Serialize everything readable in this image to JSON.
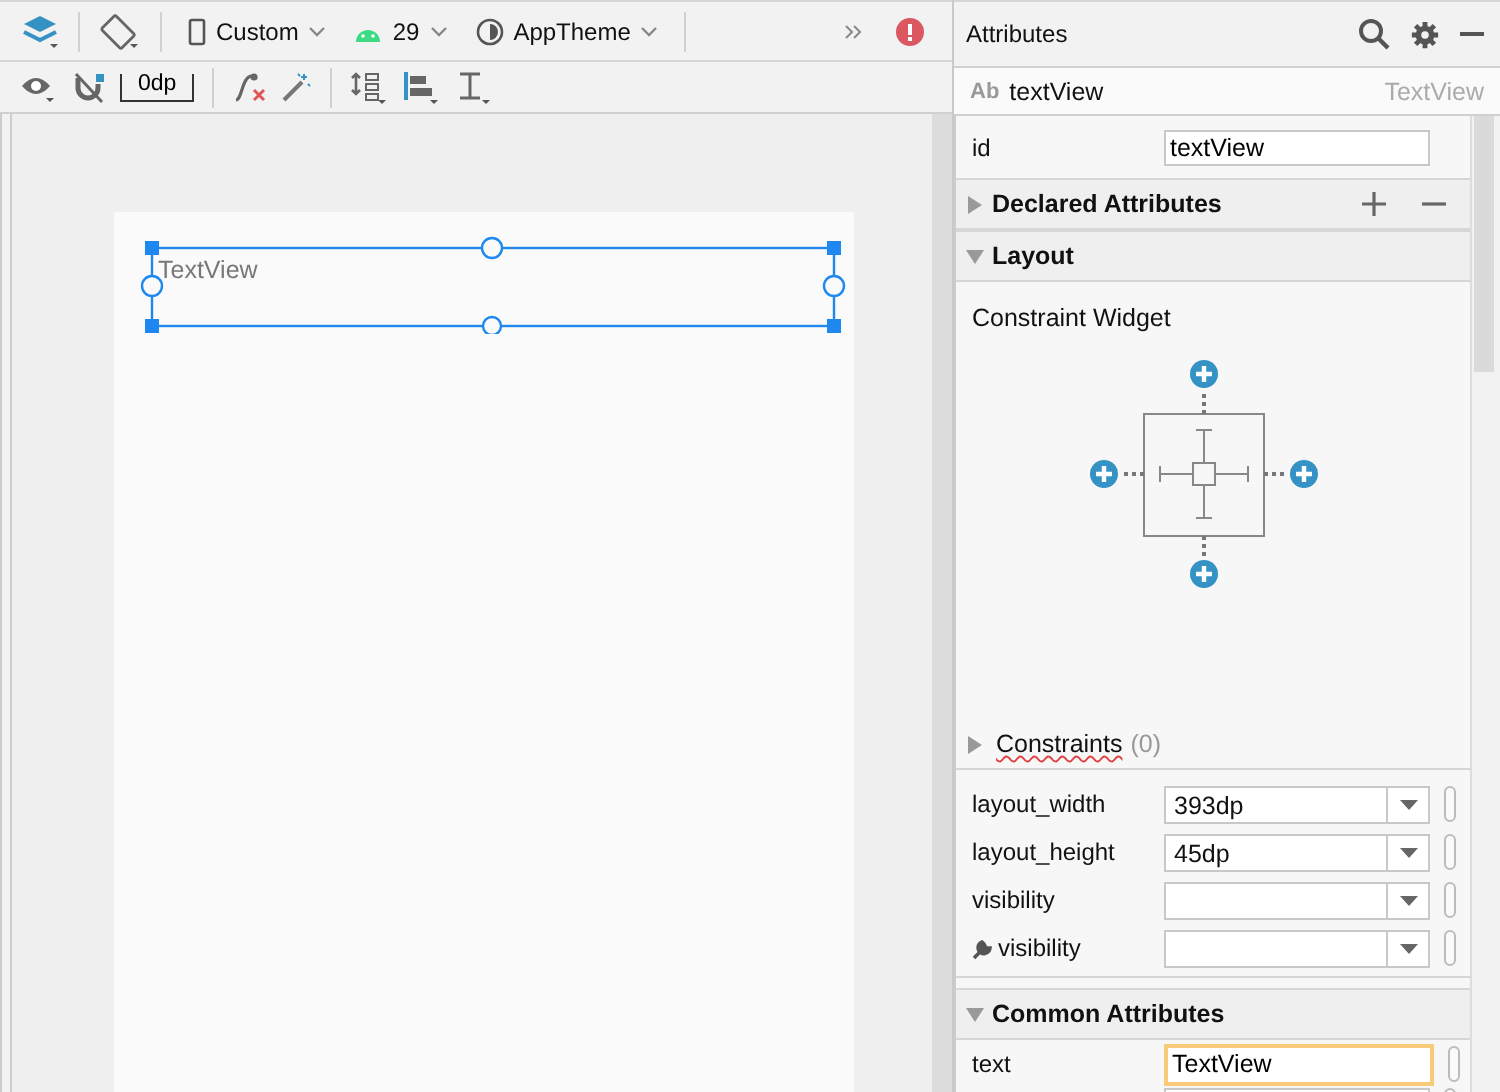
{
  "toolbar": {
    "device": "Custom",
    "api_level": "29",
    "theme": "AppTheme",
    "default_margin": "0dp",
    "has_error": true
  },
  "canvas": {
    "selected": true,
    "widget_text": "TextView"
  },
  "attributes": {
    "title": "Attributes",
    "component": {
      "type_badge": "Ab",
      "name": "textView",
      "class": "TextView"
    },
    "id": {
      "label": "id",
      "value": "textView"
    },
    "sections": [
      {
        "kind": "declared",
        "title": "Declared Attributes",
        "expanded": false
      },
      {
        "kind": "layout",
        "title": "Layout",
        "expanded": true,
        "subtitle": "Constraint Widget",
        "constraints": {
          "label": "Constraints",
          "count": "(0)",
          "expanded": false
        },
        "rows": [
          {
            "label": "layout_width",
            "value": "393dp",
            "tools": false,
            "kind": "dropdown"
          },
          {
            "label": "layout_height",
            "value": "45dp",
            "tools": false,
            "kind": "dropdown"
          },
          {
            "label": "visibility",
            "tools": false,
            "kind": "dropdown"
          },
          {
            "label": "visibility",
            "tools": true,
            "kind": "dropdown"
          }
        ]
      },
      {
        "kind": "common",
        "title": "Common Attributes",
        "expanded": true,
        "rows": [
          {
            "label": "text",
            "value": "TextView",
            "tools": false,
            "kind": "text",
            "focused": true
          }
        ]
      }
    ]
  }
}
